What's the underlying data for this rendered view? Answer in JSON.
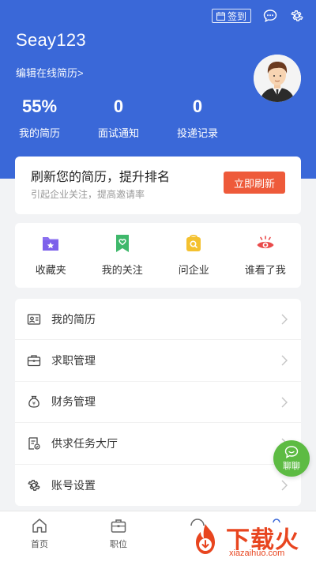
{
  "header": {
    "checkin_label": "签到",
    "username": "Seay123",
    "edit_resume": "编辑在线简历>",
    "stats": [
      {
        "value": "55%",
        "label": "我的简历"
      },
      {
        "value": "0",
        "label": "面试通知"
      },
      {
        "value": "0",
        "label": "投递记录"
      }
    ]
  },
  "refresh_card": {
    "title": "刷新您的简历，提升排名",
    "subtitle": "引起企业关注，提高邀请率",
    "button": "立即刷新"
  },
  "quick_actions": [
    {
      "label": "收藏夹",
      "icon": "folder-star-icon"
    },
    {
      "label": "我的关注",
      "icon": "bookmark-heart-icon"
    },
    {
      "label": "问企业",
      "icon": "question-bag-icon"
    },
    {
      "label": "谁看了我",
      "icon": "eye-icon"
    }
  ],
  "menu": [
    {
      "label": "我的简历",
      "icon": "resume-icon"
    },
    {
      "label": "求职管理",
      "icon": "briefcase-icon"
    },
    {
      "label": "财务管理",
      "icon": "money-bag-icon"
    },
    {
      "label": "供求任务大厅",
      "icon": "task-list-icon"
    },
    {
      "label": "账号设置",
      "icon": "gear-icon"
    }
  ],
  "chat_fab": {
    "label": "聊聊"
  },
  "tabbar": [
    {
      "label": "首页",
      "icon": "home-icon"
    },
    {
      "label": "职位",
      "icon": "briefcase-icon"
    },
    {
      "label": "",
      "icon": "message-icon"
    },
    {
      "label": "",
      "icon": "profile-icon"
    }
  ],
  "watermark": {
    "title": "下载火",
    "url": "xiazaihuo.com"
  },
  "colors": {
    "primary": "#3a68d8",
    "accent": "#ee5a3a",
    "chat": "#5dbb43"
  }
}
